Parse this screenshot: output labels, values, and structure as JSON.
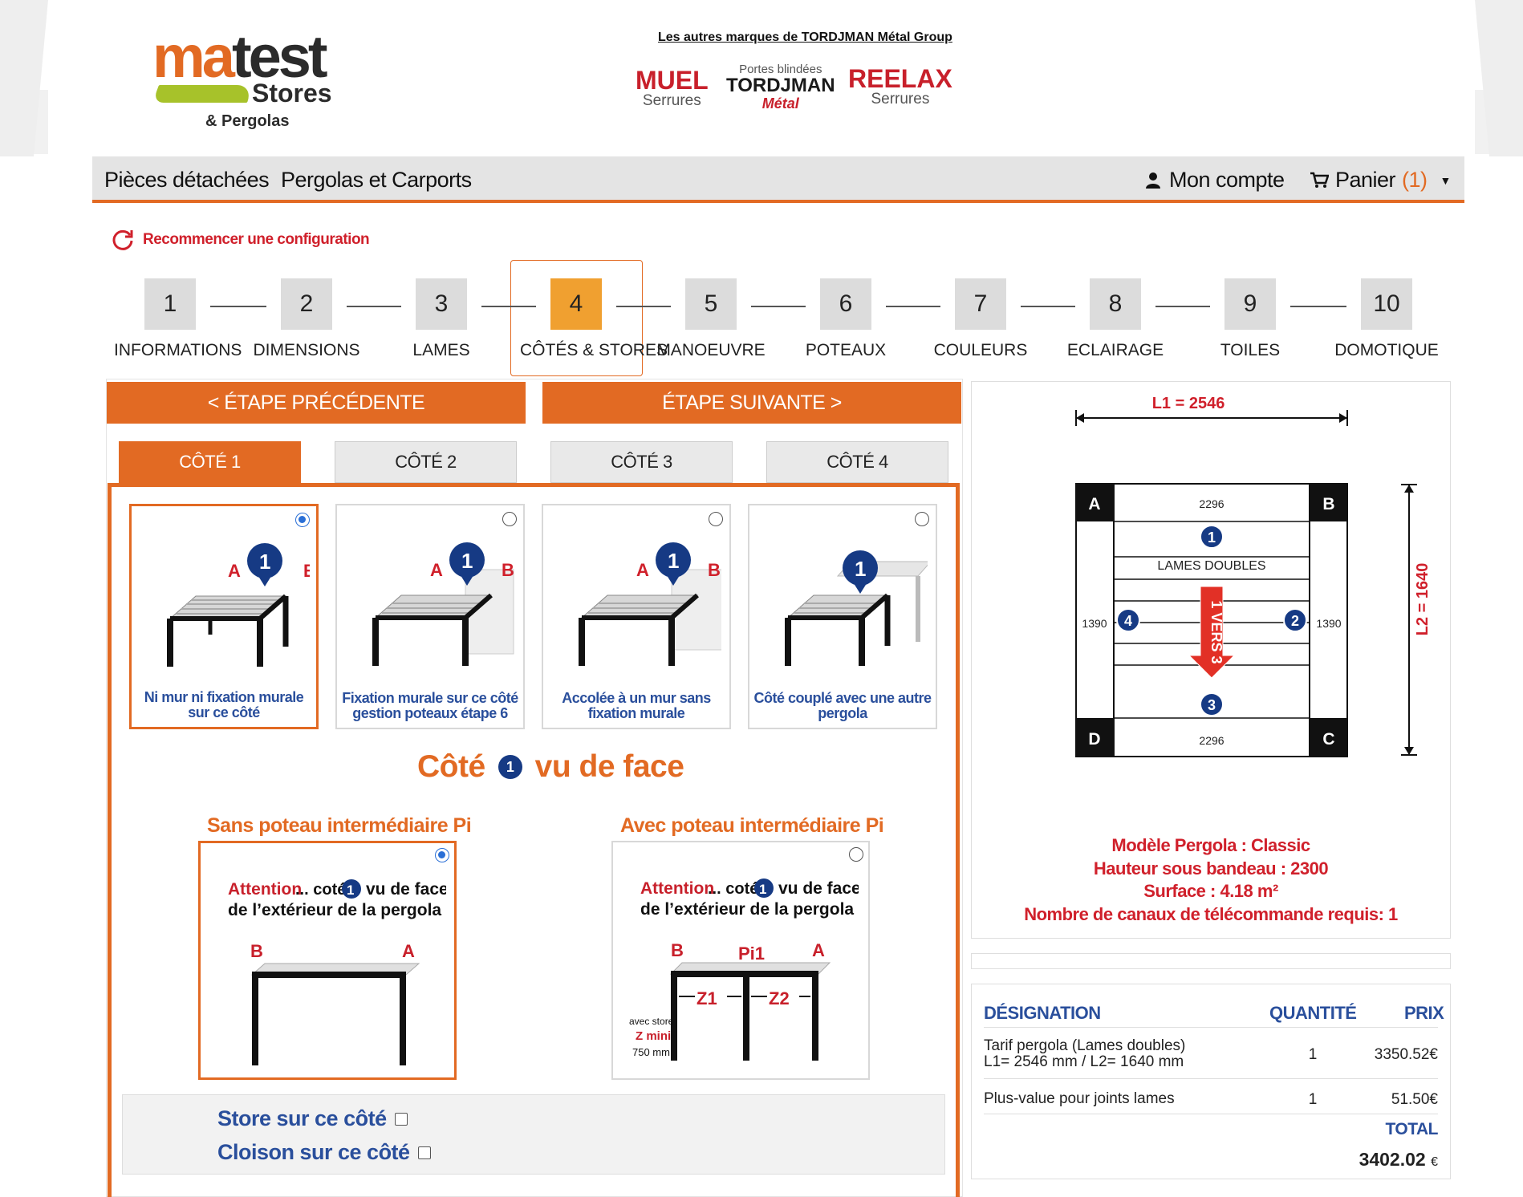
{
  "header": {
    "logo": {
      "main_a": "ma",
      "main_b": "test",
      "stores": "Stores",
      "sub": "& Pergolas"
    },
    "brands_title": "Les autres marques de TORDJMAN Métal Group",
    "brands": {
      "muel": {
        "name": "MUEL",
        "sub": "Serrures"
      },
      "tordjman": {
        "top": "Portes blindées",
        "name": "TORDJMAN",
        "script": "Métal"
      },
      "reelax": {
        "name": "REELAX",
        "sub": "Serrures"
      }
    }
  },
  "nav": {
    "pieces": "Pièces détachées",
    "pergolas": "Pergolas et Carports",
    "account": "Mon compte",
    "cart": "Panier",
    "cart_count": "(1)"
  },
  "restart": "Recommencer une configuration",
  "steps": [
    {
      "num": "1",
      "label": "INFORMATIONS"
    },
    {
      "num": "2",
      "label": "DIMENSIONS"
    },
    {
      "num": "3",
      "label": "LAMES"
    },
    {
      "num": "4",
      "label": "CÔTÉS & STORES"
    },
    {
      "num": "5",
      "label": "MANOEUVRE"
    },
    {
      "num": "6",
      "label": "POTEAUX"
    },
    {
      "num": "7",
      "label": "COULEURS"
    },
    {
      "num": "8",
      "label": "ECLAIRAGE"
    },
    {
      "num": "9",
      "label": "TOILES"
    },
    {
      "num": "10",
      "label": "DOMOTIQUE"
    }
  ],
  "active_step": "4",
  "buttons": {
    "prev": "< ÉTAPE PRÉCÉDENTE",
    "next": "ÉTAPE SUIVANTE >"
  },
  "tabs": [
    "CÔTÉ 1",
    "CÔTÉ 2",
    "CÔTÉ 3",
    "CÔTÉ 4"
  ],
  "options": [
    {
      "label": "Ni mur ni fixation murale sur ce côté",
      "selected": true
    },
    {
      "label": "Fixation murale sur ce côté gestion poteaux étape 6",
      "selected": false
    },
    {
      "label": "Accolée à un mur sans fixation murale",
      "selected": false
    },
    {
      "label": "Côté couplé avec une autre pergola",
      "selected": false
    }
  ],
  "face": {
    "prefix": "Côté",
    "num": "1",
    "suffix": "vu de face"
  },
  "posts": {
    "without": "Sans poteau intermédiaire Pi",
    "with": "Avec poteau intermédiaire Pi",
    "attention": "Attention",
    "cote": "... coté",
    "vu_face": "vu de face",
    "exterieur": "de l’extérieur de la pergola",
    "avec_store": "avec store",
    "z_mini": "Z mini",
    "mm750": "750 mm",
    "pi1": "Pi1",
    "z1": "Z1",
    "z2": "Z2",
    "a": "A",
    "b": "B"
  },
  "checks": {
    "store": "Store sur ce côté",
    "cloison": "Cloison sur ce côté"
  },
  "diagram": {
    "l1": "L1 = 2546",
    "l2": "L2 = 1640",
    "top_width": "2296",
    "bottom_width": "2296",
    "left_depth": "1390",
    "right_depth": "1390",
    "lames": "LAMES DOUBLES",
    "arrow": "1 VERS 3",
    "corners": [
      "A",
      "B",
      "C",
      "D"
    ],
    "sides": [
      "1",
      "2",
      "3",
      "4"
    ]
  },
  "model": {
    "modele": "Modèle Pergola : Classic",
    "hauteur": "Hauteur sous bandeau : 2300",
    "surface": "Surface : 4.18 m²",
    "canaux": "Nombre de canaux de télécommande requis: 1"
  },
  "pricing": {
    "headers": {
      "designation": "DÉSIGNATION",
      "quantite": "QUANTITÉ",
      "prix": "PRIX"
    },
    "rows": [
      {
        "line1": "Tarif pergola (Lames doubles)",
        "line2": "L1= 2546 mm / L2= 1640 mm",
        "qty": "1",
        "price": "3350.52€"
      },
      {
        "line1": "Plus-value pour joints lames",
        "qty": "1",
        "price": "51.50€"
      }
    ],
    "total_label": "TOTAL",
    "total_value": "3402.02",
    "currency": "€"
  },
  "colors": {
    "accent": "#e26a23",
    "step_active": "#f0a030",
    "blue": "#2a4f9c",
    "red": "#d0202b",
    "badge": "#163a84"
  }
}
